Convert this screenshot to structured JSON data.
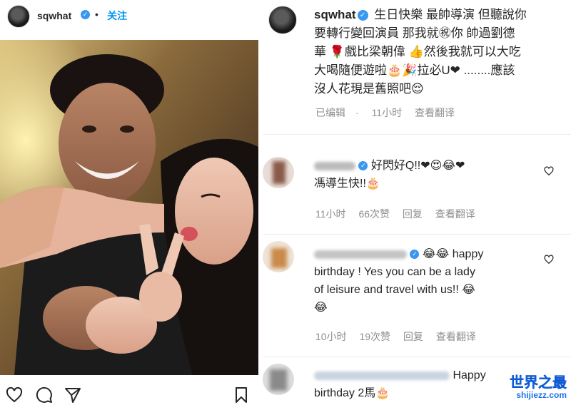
{
  "left": {
    "username": "sqwhat",
    "verified_mark": "✓",
    "separator": "•",
    "follow_label": "关注",
    "actions": [
      "heart-icon",
      "comment-icon",
      "share-icon",
      "bookmark-icon"
    ]
  },
  "post": {
    "username": "sqwhat",
    "verified_mark": "✓",
    "caption_lines": [
      "生日快樂 最帥導演 但聽說你",
      "要轉行變回演員 那我就㊗你 帥過劉德",
      "華 🌹戲比梁朝偉 👍然後我就可以大吃",
      "大喝隨便遊啦🎂🎉拉必U❤ ........應該",
      "沒人花現是舊照吧😌"
    ],
    "edited_label": "已编辑",
    "time": "11小时",
    "translate_label": "查看翻译"
  },
  "comments": [
    {
      "verified_mark": "✓",
      "line1": "好閃好Q!!❤😍😂❤",
      "line2": "馮導生快!!🎂",
      "time": "11小时",
      "likes": "66次赞",
      "reply_label": "回复",
      "translate_label": "查看翻译"
    },
    {
      "verified_mark": "✓",
      "line1": "😂😂 happy",
      "line2": "birthday ! Yes you can be a lady",
      "line3": "of leisure and travel with us!! 😂",
      "line4": "😂",
      "time": "10小时",
      "likes": "19次赞",
      "reply_label": "回复",
      "translate_label": "查看翻译"
    },
    {
      "line1": "Happy",
      "line2": "birthday 2馬🎂"
    }
  ],
  "watermark": {
    "main": "世界之最",
    "sub": "shijiezz.com"
  },
  "colors": {
    "accent": "#0095f6",
    "verified": "#3897f0",
    "muted": "#8e8e8e",
    "watermark": "#1a73e8"
  }
}
